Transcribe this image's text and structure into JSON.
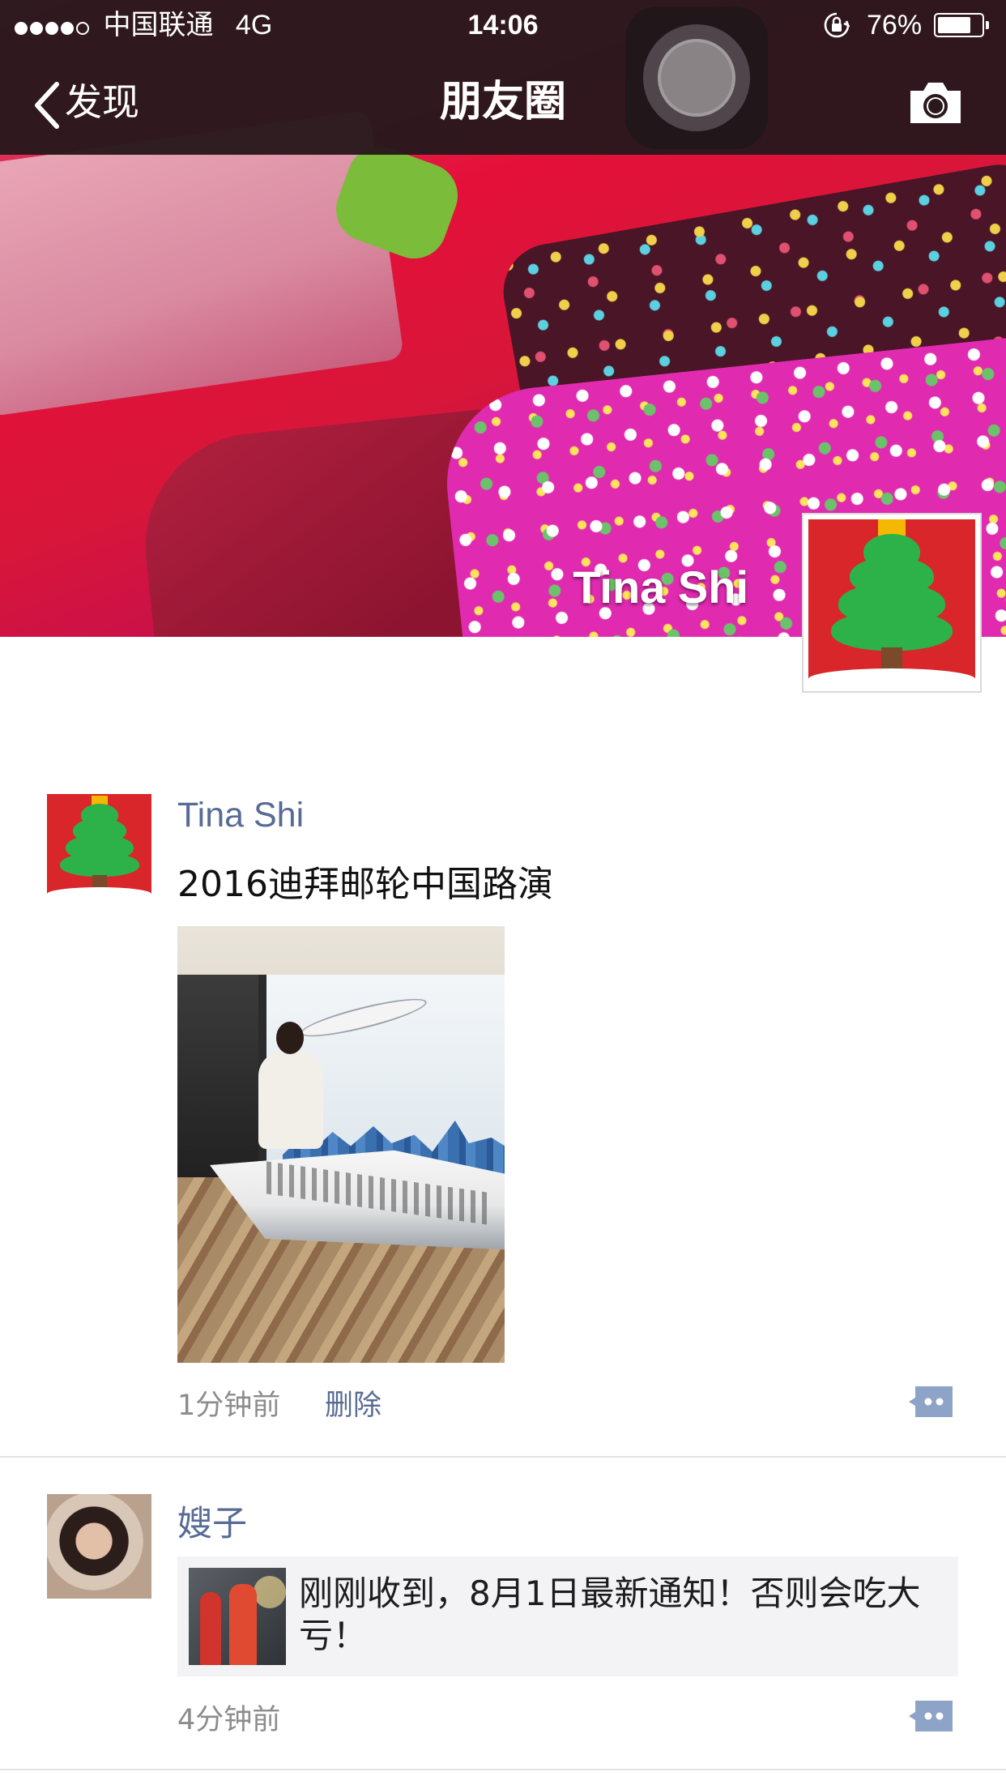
{
  "status_bar": {
    "carrier": "中国联通",
    "network": "4G",
    "time": "14:06",
    "battery_percent": "76%",
    "battery_level": 0.76,
    "signal_bars_filled": 4,
    "signal_bars_total": 5
  },
  "nav": {
    "back_label": "发现",
    "title": "朋友圈"
  },
  "cover": {
    "user_name": "Tina Shi"
  },
  "posts": [
    {
      "name": "Tina Shi",
      "text": "2016迪拜邮轮中国路演",
      "time": "1分钟前",
      "delete_label": "删除"
    },
    {
      "name": "嫂子",
      "share_title": "刚刚收到，8月1日最新通知！否则会吃大亏！",
      "time": "4分钟前"
    }
  ],
  "icons": {
    "back": "chevron-left-icon",
    "camera": "camera-icon",
    "orientation_lock": "orientation-lock-icon",
    "comment": "comment-icon"
  },
  "colors": {
    "nav_background": "#2a181c",
    "link_name": "#576b95",
    "time_gray": "#8c8c8c",
    "comment_button": "#8da3c7"
  }
}
